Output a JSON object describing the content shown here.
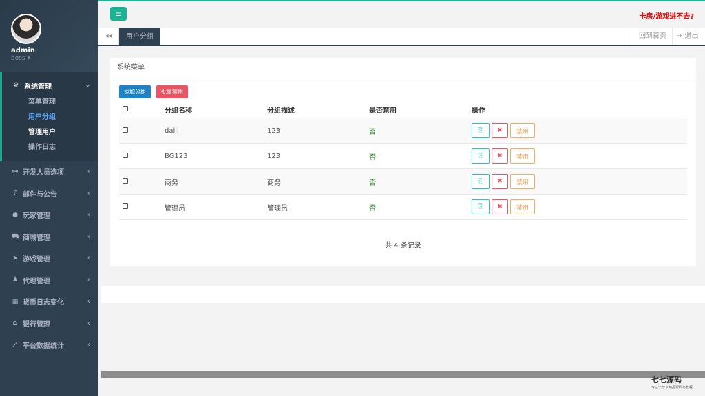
{
  "profile": {
    "name": "admin",
    "role": "boss ▾"
  },
  "sidebar": {
    "open_group": {
      "label": "系统管理",
      "icon": "gears-icon",
      "items": [
        {
          "label": "菜单管理",
          "state": "normal"
        },
        {
          "label": "用户分组",
          "state": "active"
        },
        {
          "label": "管理用户",
          "state": "hover"
        },
        {
          "label": "操作日志",
          "state": "normal"
        }
      ]
    },
    "groups": [
      {
        "label": "开发人员选项",
        "icon": "gamepad-icon",
        "glyph": "⊶"
      },
      {
        "label": "邮件与公告",
        "icon": "bell-icon",
        "glyph": "♪"
      },
      {
        "label": "玩家管理",
        "icon": "user-icon",
        "glyph": "●"
      },
      {
        "label": "商城管理",
        "icon": "cart-icon",
        "glyph": "⛟"
      },
      {
        "label": "游戏管理",
        "icon": "rocket-icon",
        "glyph": "➤"
      },
      {
        "label": "代理管理",
        "icon": "user-secret-icon",
        "glyph": "♟"
      },
      {
        "label": "货币日志变化",
        "icon": "calendar-icon",
        "glyph": "▦"
      },
      {
        "label": "银行管理",
        "icon": "bank-icon",
        "glyph": "⌂"
      },
      {
        "label": "平台数据统计",
        "icon": "line-chart-icon",
        "glyph": "⟋"
      }
    ]
  },
  "topbar": {
    "menu_glyph": "≡",
    "alert_text": "卡房/游戏进不去?"
  },
  "tabs": {
    "back_glyph": "◂◂",
    "active_tab": "用户分组",
    "home_label": "回到首页",
    "logout_label": "⇥ 退出"
  },
  "panel": {
    "title": "系统菜单",
    "add_button": "添加分组",
    "batch_ban_button": "批量禁用",
    "columns": [
      "分组名称",
      "分组描述",
      "是否禁用",
      "操作"
    ],
    "rows": [
      {
        "name": "daili",
        "desc": "123",
        "banned": "否"
      },
      {
        "name": "BG123",
        "desc": "123",
        "banned": "否"
      },
      {
        "name": "商务",
        "desc": "商务",
        "banned": "否"
      },
      {
        "name": "管理员",
        "desc": "管理员",
        "banned": "否"
      }
    ],
    "op_copy_glyph": "⎘",
    "op_delete_glyph": "✖",
    "op_disable_label": "禁用",
    "total_text": "共 4 条记录"
  },
  "watermark": {
    "brand": "七七源码",
    "tagline": "专注于分享精品源码与教程"
  },
  "colors": {
    "sidebar_bg": "#2f4050",
    "accent_green": "#1ab394",
    "primary_blue": "#1c84c6",
    "danger_red": "#ed5565",
    "warning_orange": "#f8ac59",
    "info_teal": "#23c6c8",
    "alert_red": "#ed0000"
  }
}
